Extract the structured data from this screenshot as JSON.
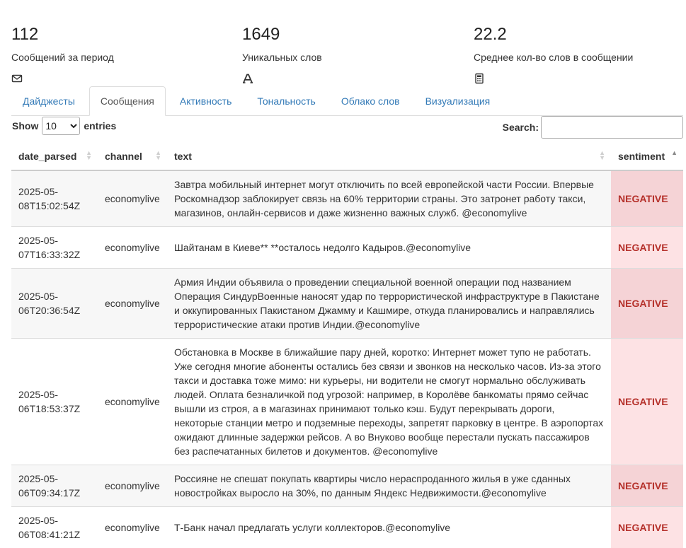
{
  "stats": [
    {
      "value": "112",
      "label": "Сообщений за период",
      "icon": "envelope-icon"
    },
    {
      "value": "1649",
      "label": "Уникальных слов",
      "icon": "font-icon"
    },
    {
      "value": "22.2",
      "label": "Среднее кол-во слов в сообщении",
      "icon": "calculator-icon"
    }
  ],
  "tabs": [
    {
      "label": "Дайджесты",
      "active": false
    },
    {
      "label": "Сообщения",
      "active": true
    },
    {
      "label": "Активность",
      "active": false
    },
    {
      "label": "Тональность",
      "active": false
    },
    {
      "label": "Облако слов",
      "active": false
    },
    {
      "label": "Визуализация",
      "active": false
    }
  ],
  "table_controls": {
    "show_label": "Show",
    "entries_value": "10",
    "entries_label": "entries",
    "search_label": "Search:",
    "search_value": ""
  },
  "columns": [
    "date_parsed",
    "channel",
    "text",
    "sentiment"
  ],
  "rows": [
    {
      "date": "2025-05-08T15:02:54Z",
      "channel": "economylive",
      "text": "Завтра мобильный интернет могут отключить по всей европейской части России. Впервые Роскомнадзор заблокирует связь на 60% территории страны. Это затронет работу такси, магазинов, онлайн-сервисов и даже жизненно важных служб. @economylive",
      "sentiment": "NEGATIVE"
    },
    {
      "date": "2025-05-07T16:33:32Z",
      "channel": "economylive",
      "text": "Шайтанам в Киеве** **осталось недолго Кадыров.@economylive",
      "sentiment": "NEGATIVE"
    },
    {
      "date": "2025-05-06T20:36:54Z",
      "channel": "economylive",
      "text": "Армия Индии объявила о проведении специальной военной операции под названием Операция СиндурВоенные наносят удар по террористической инфраструктуре в Пакистане и оккупированных Пакистаном Джамму и Кашмире, откуда планировались и направлялись террористические атаки против Индии.@economylive",
      "sentiment": "NEGATIVE"
    },
    {
      "date": "2025-05-06T18:53:37Z",
      "channel": "economylive",
      "text": "Обстановка в Москве в ближайшие пару дней, коротко: Интернет может тупо не работать. Уже сегодня многие абоненты остались без связи и звонков на несколько часов. Из-за этого такси и доставка тоже мимо: ни курьеры, ни водители не смогут нормально обслуживать людей. Оплата безналичкой под угрозой: например, в Королёве банкоматы прямо сейчас вышли из строя, а в магазинах принимают только кэш. Будут перекрывать дороги, некоторые станции метро и подземные переходы, запретят парковку в центре. В аэропортах ожидают длинные задержки рейсов. А во Внуково вообще перестали пускать пассажиров без распечатанных билетов и документов. @economylive",
      "sentiment": "NEGATIVE"
    },
    {
      "date": "2025-05-06T09:34:17Z",
      "channel": "economylive",
      "text": "Россияне не спешат покупать квартиры число нераспроданного жилья в уже сданных новостройках выросло на 30%, по данным Яндекс Недвижимости.@economylive",
      "sentiment": "NEGATIVE"
    },
    {
      "date": "2025-05-06T08:41:21Z",
      "channel": "economylive",
      "text": "Т-Банк начал предлагать услуги коллекторов.@economylive",
      "sentiment": "NEGATIVE"
    }
  ],
  "colors": {
    "link": "#337ab7",
    "negative_text": "#b5302a",
    "negative_bg": "#fde2e4"
  }
}
